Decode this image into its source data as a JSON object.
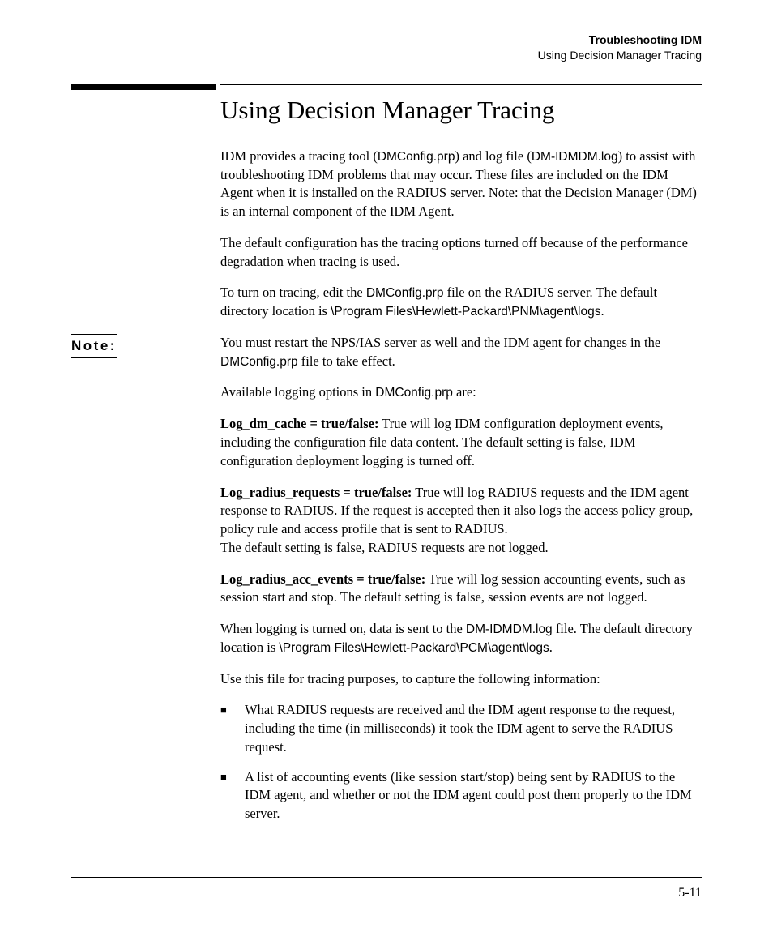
{
  "header": {
    "line1": "Troubleshooting IDM",
    "line2": "Using Decision Manager Tracing"
  },
  "title": "Using Decision Manager Tracing",
  "p1": {
    "a": "IDM provides a tracing tool (",
    "f1": "DMConfig.prp",
    "b": ") and log file (",
    "f2": "DM-IDMDM.log",
    "c": ") to assist with troubleshooting IDM problems that may occur. These files are included on the IDM Agent when it is installed on the RADIUS server. Note: that the Decision Manager (DM) is an internal component of the IDM Agent."
  },
  "p2": "The default configuration has the tracing options turned off because of the performance degradation when tracing is used.",
  "p3": {
    "a": "To turn on tracing, edit the ",
    "f1": "DMConfig.prp",
    "b": " file on the RADIUS server. The default directory location is ",
    "f2": "\\Program Files\\Hewlett-Packard\\PNM\\agent\\logs",
    "c": "."
  },
  "note": {
    "label": "Note:",
    "a": "You must restart the NPS/IAS server as well and the IDM agent for changes in the ",
    "f1": "DMConfig.prp",
    "b": " file to take effect."
  },
  "p4": {
    "a": "Available logging options in ",
    "f1": "DMConfig.prp",
    "b": " are:"
  },
  "opt1": {
    "label": "Log_dm_cache = true/false:",
    "text": " True will log IDM configuration deployment events, including the configuration file data content. The default setting is false, IDM configuration deployment logging is turned off."
  },
  "opt2": {
    "label": "Log_radius_requests = true/false:",
    "text": " True will log RADIUS requests and the IDM agent response to RADIUS. If the request is accepted then it also logs the access policy group, policy rule and access profile that is sent to RADIUS.",
    "text2": "The default setting is false, RADIUS requests are not logged."
  },
  "opt3": {
    "label": "Log_radius_acc_events = true/false:",
    "text": " True will log session accounting events, such as session start and stop. The default setting is false, session events are not logged."
  },
  "p5": {
    "a": "When logging is turned on, data is sent to the ",
    "f1": "DM-IDMDM.log",
    "b": " file. The default directory location is ",
    "f2": "\\Program Files\\Hewlett-Packard\\PCM\\agent\\logs",
    "c": "."
  },
  "p6": "Use this file for tracing purposes, to capture the following information:",
  "bullets": [
    "What RADIUS requests are received and the IDM agent response to the request, including the time (in milliseconds) it took the IDM agent to serve the RADIUS request.",
    "A list of accounting events (like session start/stop) being sent by RADIUS to the IDM agent, and whether or not the IDM agent could post them properly to the IDM server."
  ],
  "pagenum": "5-11"
}
